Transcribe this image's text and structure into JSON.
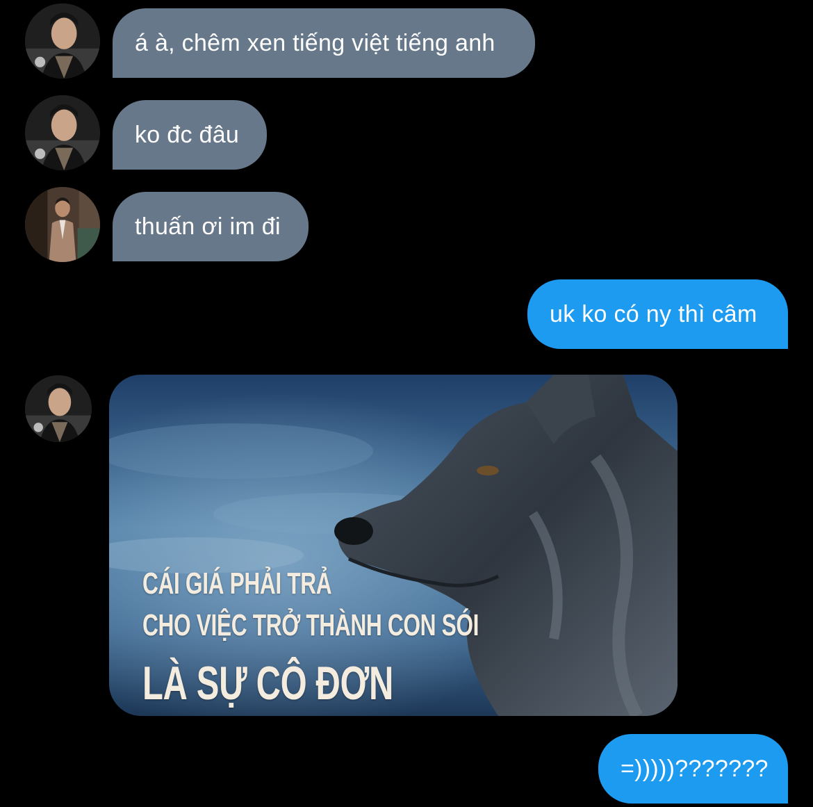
{
  "messages": {
    "m1": {
      "text": "á à, chêm xen tiếng việt tiếng anh"
    },
    "m2": {
      "text": "ko đc đâu"
    },
    "m3": {
      "text": "thuấn ơi im đi"
    },
    "m4": {
      "text": "uk ko có ny thì câm"
    },
    "m6": {
      "text": "=)))))???????"
    }
  },
  "meme": {
    "line1": "CÁI GIÁ PHẢI TRẢ",
    "line2": "CHO VIỆC TRỞ THÀNH CON SÓI",
    "line3": "LÀ SỰ CÔ ĐƠN"
  },
  "colors": {
    "background": "#000000",
    "incoming_bubble": "#67788a",
    "outgoing_bubble": "#1d9bf0",
    "text": "#ffffff"
  }
}
